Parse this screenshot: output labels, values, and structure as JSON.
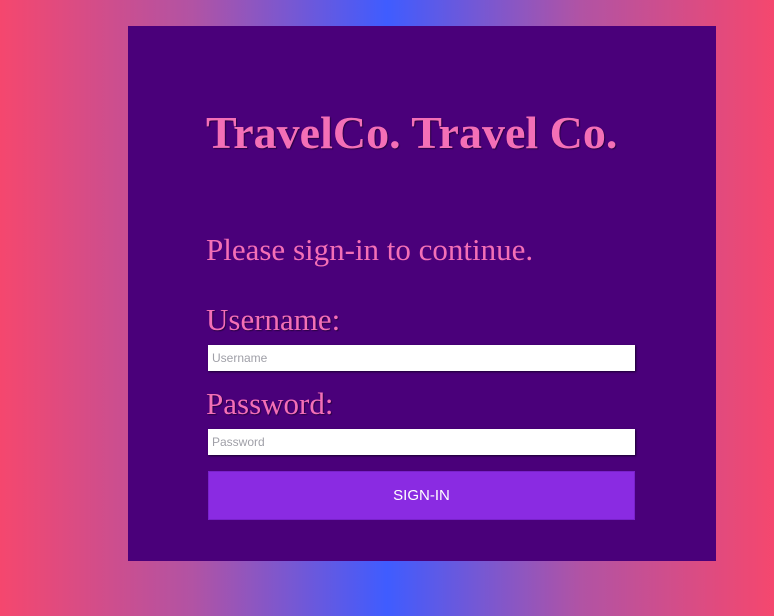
{
  "header": {
    "title": "TravelCo. Travel Co."
  },
  "form": {
    "prompt": "Please sign-in to continue.",
    "username_label": "Username:",
    "username_placeholder": "Username",
    "username_value": "",
    "password_label": "Password:",
    "password_placeholder": "Password",
    "password_value": "",
    "submit_label": "SIGN-IN"
  },
  "colors": {
    "card": "#4a007a",
    "text": "#f46fb6",
    "button": "#8a2be2"
  }
}
